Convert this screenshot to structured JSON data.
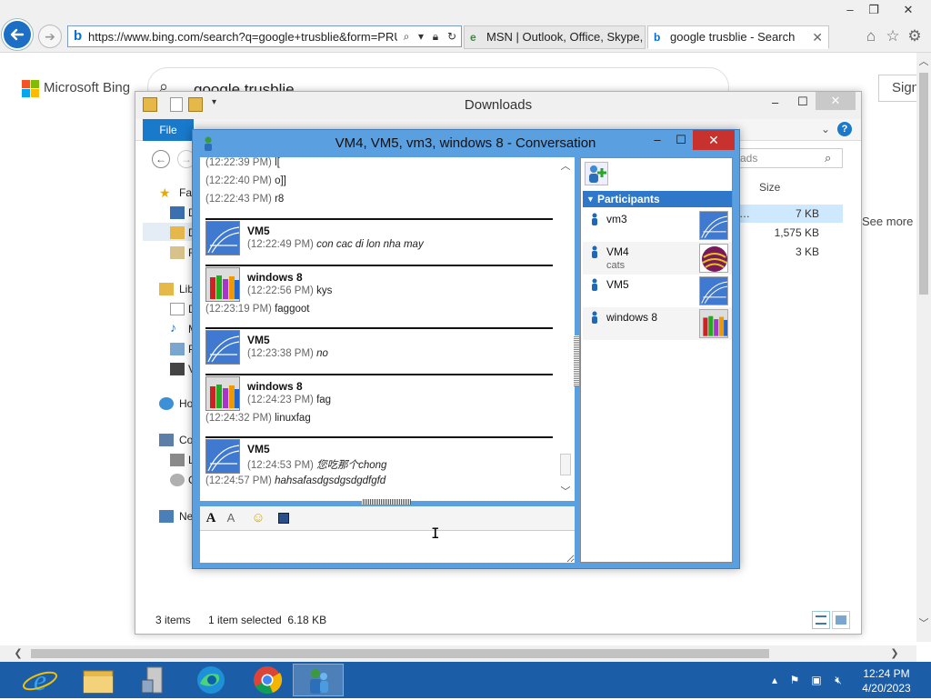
{
  "browser": {
    "url": "https://www.bing.com/search?q=google+trusblie&form=PRUSE",
    "tabs": [
      {
        "label": "MSN | Outlook, Office, Skype, ..."
      },
      {
        "label": "google trusblie - Search"
      }
    ],
    "controls": {
      "minimize": "–",
      "restore": "❐",
      "close": "✕"
    }
  },
  "bing": {
    "logo_text": "Microsoft Bing",
    "search_query": "google trusblie",
    "signin_label": "Sign",
    "see_more_label": "See more"
  },
  "explorer": {
    "title": "Downloads",
    "file_tab": "File",
    "search_placeholder": "ads",
    "column_size": "Size",
    "sidebar": [
      {
        "label": "Fav"
      },
      {
        "label": "D"
      },
      {
        "label": "D"
      },
      {
        "label": "R"
      },
      {
        "label": "Libr"
      },
      {
        "label": "D"
      },
      {
        "label": "M"
      },
      {
        "label": "P"
      },
      {
        "label": "V"
      },
      {
        "label": "Ho"
      },
      {
        "label": "Co"
      },
      {
        "label": "L"
      },
      {
        "label": "C"
      },
      {
        "label": "Ne"
      }
    ],
    "files": [
      {
        "size": "7 KB"
      },
      {
        "size": "1,575 KB"
      },
      {
        "size": "3 KB"
      }
    ],
    "status": {
      "items": "3 items",
      "selected": "1 item selected  6.18 KB"
    }
  },
  "conversation": {
    "title": "VM4, VM5, vm3, windows 8 - Conversation",
    "history": {
      "top_lines": [
        {
          "ts": "(12:22:39 PM)",
          "text": "l["
        },
        {
          "ts": "(12:22:40 PM)",
          "text": "o]]"
        },
        {
          "ts": "(12:22:43 PM)",
          "text": "r8"
        }
      ],
      "blocks": [
        {
          "sender": "VM5",
          "avatar": "blue",
          "lines": [
            {
              "ts": "(12:22:49 PM)",
              "text": "con cac di lon nha may",
              "italic": true
            }
          ]
        },
        {
          "sender": "windows 8",
          "avatar": "crayons",
          "lines": [
            {
              "ts": "(12:22:56 PM)",
              "text": "kys",
              "italic": false
            },
            {
              "ts": "(12:23:19 PM)",
              "text": "faggoot",
              "italic": false
            }
          ]
        },
        {
          "sender": "VM5",
          "avatar": "blue",
          "lines": [
            {
              "ts": "(12:23:38 PM)",
              "text": "no",
              "italic": true
            }
          ]
        },
        {
          "sender": "windows 8",
          "avatar": "crayons",
          "lines": [
            {
              "ts": "(12:24:23 PM)",
              "text": "fag",
              "italic": false
            },
            {
              "ts": "(12:24:32 PM)",
              "text": "linuxfag",
              "italic": false
            }
          ]
        },
        {
          "sender": "VM5",
          "avatar": "blue",
          "lines": [
            {
              "ts": "(12:24:53 PM)",
              "text": "您吃那个chong",
              "italic": true
            },
            {
              "ts": "(12:24:57 PM)",
              "text": "hahsafasdgsdgsdgdfgfd",
              "italic": true
            }
          ]
        }
      ]
    },
    "compose_value": "",
    "participants_header": "Participants",
    "participants": [
      {
        "name": "vm3",
        "status": "",
        "avatar": "blue"
      },
      {
        "name": "VM4",
        "status": "cats",
        "avatar": "ball"
      },
      {
        "name": "VM5",
        "status": "",
        "avatar": "blue"
      },
      {
        "name": "windows 8",
        "status": "",
        "avatar": "crayons"
      }
    ]
  },
  "taskbar": {
    "clock_time": "12:24 PM",
    "clock_date": "4/20/2023"
  },
  "colors": {
    "taskbar": "#1b5da6",
    "convo_frame": "#5a9fe0",
    "close_red": "#c7322e",
    "file_tab": "#1979ca"
  }
}
